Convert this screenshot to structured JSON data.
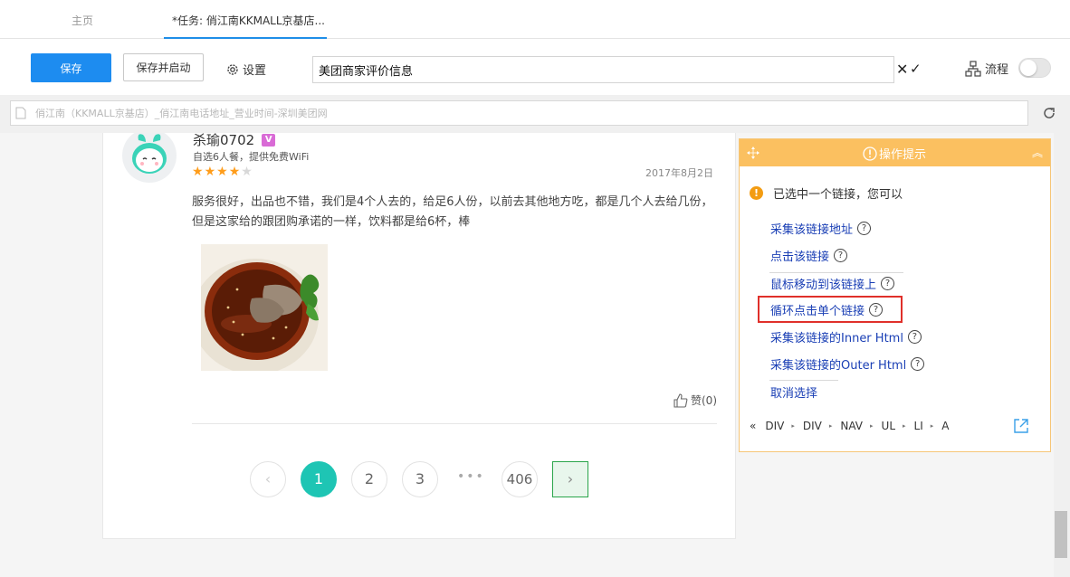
{
  "tabs": [
    {
      "label": "主页"
    },
    {
      "label": "*任务: 俏江南KKMALL京基店..."
    }
  ],
  "toolbar": {
    "save_label": "保存",
    "save_run_label": "保存并启动",
    "settings_label": "设置",
    "task_name": "美团商家评价信息",
    "cancel_glyph": "✕",
    "confirm_glyph": "✓",
    "flow_label": "流程",
    "flow_toggle_on": false
  },
  "urlbar": {
    "text": "俏江南（KKMALL京基店）_俏江南电话地址_营业时间-深圳美团网"
  },
  "review": {
    "username": "杀瑜0702",
    "badge": "V",
    "meta": "自选6人餐，提供免费WiFi",
    "rating": 4,
    "rating_max": 5,
    "star_glyph": "★",
    "date": "2017年8月2日",
    "text": "服务很好，出品也不错，我们是4个人去的，给足6人份，以前去其他地方吃，都是几个人去给几份，但是这家给的跟团购承诺的一样，饮料都是给6杯，棒",
    "like_label": "赞(0)"
  },
  "pagination": {
    "prev": "‹",
    "pages": [
      "1",
      "2",
      "3"
    ],
    "ellipsis": "•••",
    "last": "406",
    "next": "›",
    "active": "1"
  },
  "hint_panel": {
    "title": "操作提示",
    "collapse_glyph": "︽",
    "notice_icon": "!",
    "notice": "已选中一个链接，您可以",
    "help_glyph": "?",
    "actions": [
      {
        "label": "采集该链接地址"
      },
      {
        "label": "点击该链接"
      },
      {
        "label": "鼠标移动到该链接上"
      },
      {
        "label": "循环点击单个链接"
      },
      {
        "label": "采集该链接的Inner Html"
      },
      {
        "label": "采集该链接的Outer Html"
      },
      {
        "label": "取消选择"
      }
    ],
    "highlighted_action": "循环点击单个链接",
    "breadcrumb_back": "«",
    "breadcrumb_sep": "▸",
    "breadcrumb": [
      "DIV",
      "DIV",
      "NAV",
      "UL",
      "LI",
      "A"
    ]
  },
  "colors": {
    "primary": "#1d8cf0",
    "panel_header": "#fbc060",
    "link": "#1a3fb5",
    "highlight_border": "#e0302a",
    "pager_active": "#1ec5b4",
    "star": "#ff9d1b"
  }
}
